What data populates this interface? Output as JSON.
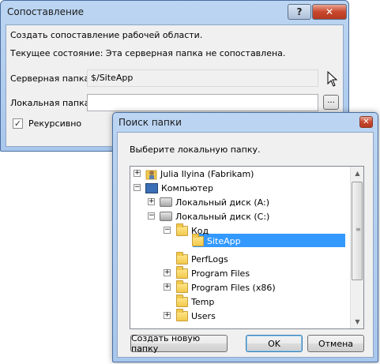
{
  "mapping_dialog": {
    "title": "Сопоставление",
    "help_label": "?",
    "close_label": "✕",
    "create_text": "Создать сопоставление рабочей области.",
    "status_text": "Текущее состояние: Эта серверная папка не сопоставлена.",
    "server_folder_label": "Серверная папка:",
    "server_folder_value": "$/SiteApp",
    "local_folder_label": "Локальная папка:",
    "local_folder_value": "",
    "browse_label": "...",
    "recursive_label": "Рекурсивно",
    "recursive_checked": true
  },
  "browse_dialog": {
    "title": "Поиск папки",
    "close_label": "✕",
    "prompt": "Выберите локальную папку.",
    "tree": {
      "user": "Julia Ilyina (Fabrikam)",
      "computer": "Компьютер",
      "drive_a": "Локальный диск (A:)",
      "drive_c": "Локальный диск (C:)",
      "folder_kod": "Код",
      "folder_siteapp": "SiteApp",
      "folder_perflogs": "PerfLogs",
      "folder_program_files": "Program Files",
      "folder_program_files_x86": "Program Files (x86)",
      "folder_temp": "Temp",
      "folder_users": "Users"
    },
    "selected_folder": "SiteApp",
    "new_folder_button": "Создать новую папку",
    "ok_button": "OK",
    "cancel_button": "Отмена"
  },
  "colors": {
    "selection": "#3399ff",
    "title_bar": "#bcd5f2"
  }
}
